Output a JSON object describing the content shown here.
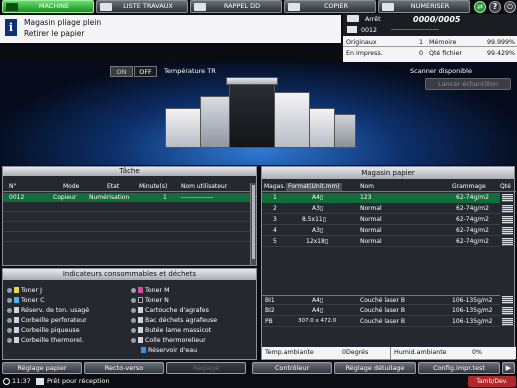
{
  "tabs": [
    {
      "label": "MACHINE",
      "active": true
    },
    {
      "label": "LISTE TRAVAUX",
      "active": false
    },
    {
      "label": "RAPPEL DD",
      "active": false
    },
    {
      "label": "COPIER",
      "active": false
    },
    {
      "label": "NUMERISER",
      "active": false
    }
  ],
  "message": {
    "line1": "Magasin pliage plein",
    "line2": "Retirer le papier"
  },
  "status": {
    "state": "Arrêt",
    "counter": "0000/0005",
    "job_id": "0012",
    "job_dashes": "------------------------",
    "originals_label": "Originaux",
    "originals_value": "1",
    "memory_label": "Mémoire",
    "memory_value": "99.999%",
    "printing_label": "En impress.",
    "printing_value": "0",
    "file_qty_label": "Qté fichier",
    "file_qty_value": "99.429%"
  },
  "banner": {
    "on_label": "ON",
    "off_label": "OFF",
    "temp_label": "Température TR",
    "scanner_label": "Scanner disponible",
    "sample_label": "Lancer échantillon"
  },
  "tasks": {
    "title": "Tâche",
    "headers": [
      "N°",
      "Mode",
      "Etat",
      "Minute(s)",
      "Nom utilisateur"
    ],
    "rows": [
      [
        "0012",
        "Copieur",
        "Numérisation",
        "1",
        "---------------"
      ]
    ]
  },
  "consumables": {
    "title": "Indicateurs consommables et déchets",
    "left": [
      "Toner J",
      "Toner C",
      "Réserv. de ton. usagé",
      "Corbeille perforateur",
      "Corbeille piqueuse",
      "Corbeille thermorel."
    ],
    "right": [
      "Toner M",
      "Toner N",
      "Cartouche d'agrafes",
      "Bac déchets agrafeuse",
      "Butée lame massicot",
      "Colle thermorelieur",
      "Réservoir d'eau"
    ]
  },
  "paper": {
    "title": "Magasin papier",
    "headers": [
      "Magas.",
      "Format(Unit.mm)",
      "Nom",
      "Grammage",
      "Qté"
    ],
    "rows": [
      [
        "1",
        "A4▯",
        "123",
        "62-74g/m2"
      ],
      [
        "2",
        "A3▯",
        "Normal",
        "62-74g/m2"
      ],
      [
        "3",
        "8.5x11▯",
        "Normal",
        "62-74g/m2"
      ],
      [
        "4",
        "A3▯",
        "Normal",
        "62-74g/m2"
      ],
      [
        "5",
        "12x18▯",
        "Normal",
        "62-74g/m2"
      ]
    ],
    "extra_rows": [
      [
        "BI1",
        "A4▯",
        "Couché laser B",
        "106-135g/m2"
      ],
      [
        "BI2",
        "A4▯",
        "Couché laser B",
        "106-135g/m2"
      ],
      [
        "PB",
        "307.0 x 472.0",
        "Couché laser B",
        "106-135g/m2"
      ]
    ],
    "temp_label": "Temp.ambiante",
    "temp_value": "0Degrés",
    "humid_label": "Humid.ambiante",
    "humid_value": "0%"
  },
  "buttons": {
    "paper_setting": "Réglage papier",
    "duplex": "Recto-verso",
    "adjust": "Réglage",
    "controller": "Contrôleur",
    "finishing_adjust": "Réglage détuilage",
    "test_print": "Config.impr.test"
  },
  "statusbar": {
    "time": "11:37",
    "ready": "Prêt pour réception",
    "toner": "Tamb/Dev."
  }
}
